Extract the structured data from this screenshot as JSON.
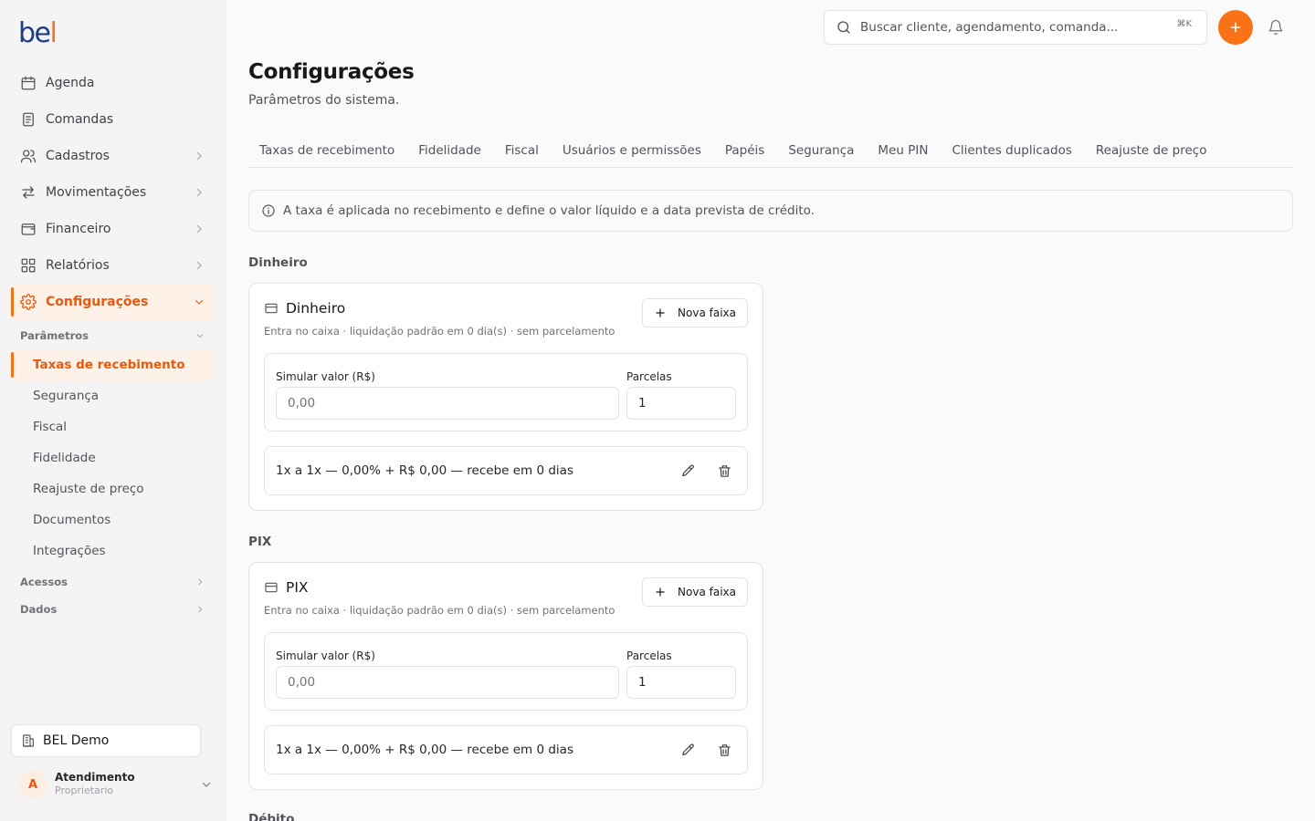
{
  "logo": {
    "part1": "be",
    "part2": "l"
  },
  "sidebar": {
    "items": [
      {
        "label": "Agenda",
        "icon": "calendar-icon",
        "has_chevron": false
      },
      {
        "label": "Comandas",
        "icon": "receipt-icon",
        "has_chevron": false
      },
      {
        "label": "Cadastros",
        "icon": "users-icon",
        "has_chevron": true
      },
      {
        "label": "Movimentações",
        "icon": "arrows-exchange-icon",
        "has_chevron": true
      },
      {
        "label": "Financeiro",
        "icon": "wallet-icon",
        "has_chevron": true
      },
      {
        "label": "Relatórios",
        "icon": "grid-icon",
        "has_chevron": true
      },
      {
        "label": "Configurações",
        "icon": "gear-icon",
        "has_chevron": true,
        "active": true
      }
    ],
    "group_parametros": "Parâmetros",
    "subitems": [
      {
        "label": "Taxas de recebimento",
        "active": true
      },
      {
        "label": "Segurança"
      },
      {
        "label": "Fiscal"
      },
      {
        "label": "Fidelidade"
      },
      {
        "label": "Reajuste de preço"
      },
      {
        "label": "Documentos"
      },
      {
        "label": "Integrações"
      }
    ],
    "group_acessos": "Acessos",
    "group_dados": "Dados",
    "org_name": "BEL Demo",
    "user": {
      "initial": "A",
      "name": "Atendimento",
      "role": "Proprietario"
    }
  },
  "topbar": {
    "search_placeholder": "Buscar cliente, agendamento, comanda...",
    "search_shortcut": "⌘K"
  },
  "page": {
    "title": "Configurações",
    "subtitle": "Parâmetros do sistema.",
    "tabs": [
      "Taxas de recebimento",
      "Fidelidade",
      "Fiscal",
      "Usuários e permissões",
      "Papéis",
      "Segurança",
      "Meu PIN",
      "Clientes duplicados",
      "Reajuste de preço"
    ],
    "info_text": "A taxa é aplicada no recebimento e define o valor líquido e a data prevista de crédito."
  },
  "sections": [
    {
      "label": "Dinheiro",
      "card_title": "Dinheiro",
      "card_desc": "Entra no caixa · liquidação padrão em 0 dia(s) · sem parcelamento",
      "new_button": "Nova faixa",
      "sim_label": "Simular valor (R$)",
      "sim_placeholder": "0,00",
      "parcelas_label": "Parcelas",
      "parcelas_value": "1",
      "faixa_text": "1x a 1x — 0,00% + R$ 0,00 — recebe em 0 dias"
    },
    {
      "label": "PIX",
      "card_title": "PIX",
      "card_desc": "Entra no caixa · liquidação padrão em 0 dia(s) · sem parcelamento",
      "new_button": "Nova faixa",
      "sim_label": "Simular valor (R$)",
      "sim_placeholder": "0,00",
      "parcelas_label": "Parcelas",
      "parcelas_value": "1",
      "faixa_text": "1x a 1x — 0,00% + R$ 0,00 — recebe em 0 dias"
    },
    {
      "label": "Débito"
    }
  ],
  "colors": {
    "accent": "#f97316",
    "brand": "#1e3a8a"
  }
}
